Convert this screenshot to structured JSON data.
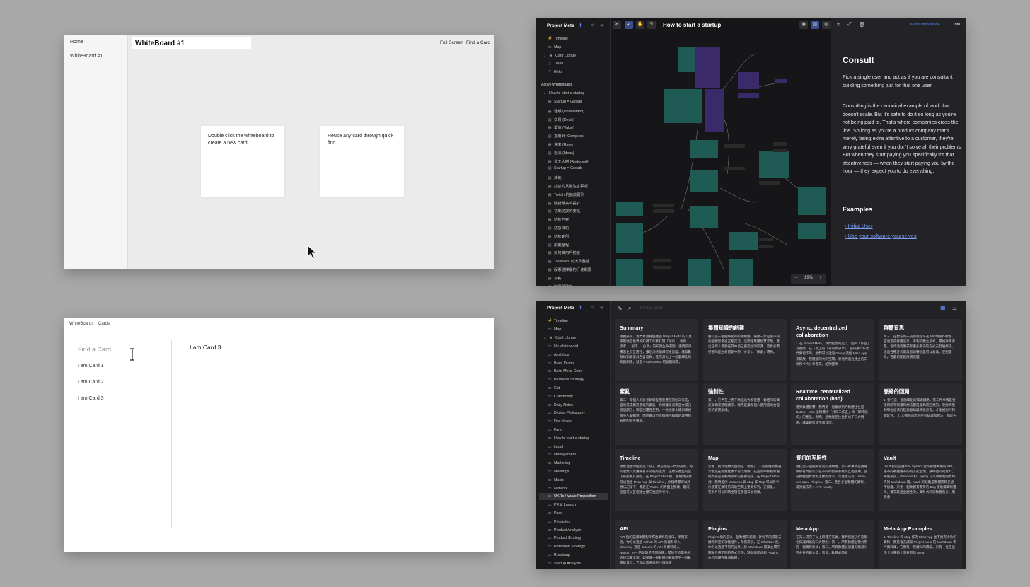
{
  "w1": {
    "sidebar_home": "Home",
    "sidebar_item": "WhiteBoard #1",
    "title": "WhiteBoard #1",
    "btn_fullscreen": "Full Screen",
    "btn_find": "Find a Card",
    "card_a": "Double click the whiteboard to create a new card.",
    "card_b": "Reuse any card through quick find."
  },
  "w2": {
    "nav_whiteboards": "WhiteBoards",
    "nav_cards": "Cards",
    "find_placeholder": "Find a Card",
    "cards": [
      "I am Card 1",
      "I am Card 2",
      "I am Card 3"
    ],
    "selected_title": "I am Card 3"
  },
  "w3": {
    "brand": "Project Meta",
    "nav": [
      "Timeline",
      "Map",
      "Card Library",
      "Trash",
      "Help"
    ],
    "active_label": "Active Whiteboard",
    "active_board": "How to start a startup",
    "board_cards": [
      "Startup = Growth",
      "理解 (Understand)",
      "交易 (Deals)",
      "價值 (Value)",
      "指南針 (Compass)",
      "速率 (Rate)",
      "想法 (Ideas)",
      "參天大樹 (Redwood)",
      "Startup = Growth",
      "其他",
      "訪談的具體注意事項",
      "Twitch 的訪談實例",
      "聽譜最高的設計",
      "初期訪談的要點",
      "訪談內容",
      "訪談目的",
      "訪談範例",
      "創業歷程",
      "如何做用戶訪談",
      "Toussaint 的大局整理",
      "股票選擇權的行使期限",
      "加薪",
      "財團與融資"
    ],
    "title": "How to start a startup",
    "markdown_mode": "MarkDown Mode",
    "info": "Info",
    "heading": "Consult",
    "p1": "Pick a single user and act as if you are consultant building something just for that one user.",
    "p2": "Consulting is the canonical example of work that doesn't scale. But it's safe to do it so long as you're not being paid to. That's where companies cross the line. So long as you're a product company that's merely being extra attentive to a customer, they're very grateful even if you don't solve all their problems. But when they start paying you specifically for that attentiveness — when they start paying you by the hour — they expect you to do everything.",
    "examples": "Examples",
    "link1": "Initial User",
    "link2": "Use your software yourselves",
    "zoom": "19%"
  },
  "w4": {
    "brand": "Project Meta",
    "search_placeholder": "Find a Card",
    "nav": [
      "Timeline",
      "Map",
      "Card Library"
    ],
    "library": [
      "No whiteboard",
      "Analytics",
      "Brain Dump",
      "Build Meta: Diary",
      "Business Strategy",
      "Cat",
      "Community",
      "Daily Notes",
      "Design Philosophy",
      "Dev Notes",
      "Fund",
      "How to start a startup",
      "Legal",
      "Management",
      "Marketing",
      "Meetings",
      "Music",
      "Network",
      "OKRs / Value Proposition",
      "PR & Launch",
      "Pass",
      "Principles",
      "Product Analysis",
      "Product Strategy",
      "Retention Strategy",
      "Roadmap",
      "Startup Analysis"
    ],
    "selected_library": "OKRs / Value Proposition",
    "cards": [
      {
        "t": "Summary",
        "b": "總體來說，我們希望藉由透過 Project Meta 的工具來幫助全世界的知識工作者打開「探索 → 收集 → 思考 → 創作 → 分享」的知識生命週期，讓資訊與備忘生於互用性，讓想法的腦細可被追蹤，讓無數散的知識更具各自發表，進而演化出一個腦細化的知識網路，就是 Project Meta 的長期願景。"
      },
      {
        "t": "集體知識的創建",
        "b": "要打造一個腦細化的知識網路，最後一步是讓不同的個體思考進互相交流，這而讓集體智慧浮現，產出任何人都能在其中自己創造出的知識，這樣必需打通的是生命週期中的「分享」、「探索」環節。"
      },
      {
        "t": "Async, decentralized collaboration",
        "b": "1. 在 Project Meta，我們提倡的是以「個人工作區」為基礎，在下而上的「非同步分享」，當知識工作者們要協作時，他們可以透過 Group 這個 Meta App 來開放一種體驗的共同空間，將他們過往建立的白板和卡片分享進來，給別團隊"
      },
      {
        "t": "群體盲思",
        "b": "第三，在想法尚未成熟就提早進入即時協作狀態，容易造成群體盲思，不利於獨立思考，最終效率考量，協作過程應該考慮多數決的方式去發展想法，透過各種方式刺激思想轉化是可以表達，使到團隊，在最初期就應該提醒。"
      },
      {
        "t": "紊亂",
        "b": "第二，每個人的思考軌跡互相重疊在同個工作區，容易造成資訊系統的紊亂，你很難知道哪些文檔已經過期了，哪些別還在使用，一份協作文檔如果被很多人編輯過，你也難以拉提每個人編輯的理由和背後的思考脈絡。"
      },
      {
        "t": "強制性",
        "b": "第一，它們在上而下地強迫大家使用一套相同的資訊架構來整理資訊，而不是讓每個人使用最適合自己的資訊架構。"
      },
      {
        "t": "Realtime, centeralized collaboration (bad)",
        "b": "提到集體智慧，我們第一個聯想到的軟體往往是 Notion、Miro 這類標榜「共同工作區」和「即時協作」的產品，然而，這類產品往往有以下三大問題，讓集體智慧不容浮現："
      },
      {
        "t": "脈絡的回溯",
        "b": "1. 要打造一個腦細化的知識網路，第二件事情是要確保所有知識和想法都是能夠被回溯的，要能夠看到每個想法的起源脈絡與背後思考，才能被別人持續延伸。 2. 人類創造出的所有知識和想法，都是先"
      },
      {
        "t": "Timeline",
        "b": "收集理想的個別是「快」，想法總是一閃即逝的，好的收集工具應擁有非常低的阻力，在想法產生的當下就能將其捕捉，在 Project Meta 裡，各種資訊都可以透過 Meta App 與 Timeline，你隨時都可以將想法記錄下，像是在 Twitter 的界面上那樣，變成一個個可以互相建立雙向連結的卡片。"
      },
      {
        "t": "Map",
        "b": "思考、創作理想的個別是「視覺」，人的思維架構通常都是在視覺化後才得以明晰，在空間中移動和重組資訊是最輔助思考的重要程序，在 Project Meta 裡，我們提供 Meta App 與 Map 作 Map 可以將卡片放置在無限的白板空間上重新排列，安排後，一張卡片可以同時出現在多個白板裡頭。"
      },
      {
        "t": "資訊的互用性",
        "b": "要打造一個腦細化的知識網路，第一件事情是要確保所有資訊可以在不同的資訊系統間互相使用，當前軟體世界針對這樣的需求，常見做法有：All-in-one app、Plugins、第二、整合多個軟體的資料、常見做法有：API、Vault。"
      },
      {
        "t": "Vault",
        "b": "Vault 指的是將 File System 當作軟體共用的 API，讓不同軟體用不同的方式呈現，讓每個同的資料，舉例來說，Obsidian 和 Logseq 可以共用相同資料夾的 Markdown 檔，Vault 的缺點是軟體間缺乏通用協議，只要一個軟體有需要的 Bug 便能讓資料遺失，擴充就是全面性的，資料共同的軟體愈多，風險愈"
      },
      {
        "t": "API",
        "b": "API 指的是讓軟體對外釋出資料的接口，舉例來說，你可以透過 Github 的 API 將資料導入 Discord，透過 Discord 的 API 將資料導入 Notion，API 的缺點是不同軟體之間的交流需要經過接口來呈現，如果某一個軟體想要取用另一個軟體的資料，它就必需通過另一個軟體"
      },
      {
        "t": "Plugins",
        "b": "Plugins 指的是以一個軟體為基礎，針對不同場景去擴充特定的功能插件，舉例來說，在 Obsidian 裡，你可以透過不同的插件，將 Markdown 檔案之間的關聯性用不同的方式呈現，缺點則是此類 Plugins 依然附屬在單個軟體，"
      },
      {
        "t": "Meta App",
        "b": "在深入研究了以上四種方法後，我們提出了打造腦化知識網路的三大原則：第一，所有軟體必需共用同一個資料格式；第二，所有軟體必須盡可能減少不必要的耦合度；第三，軟體必須能"
      },
      {
        "t": "Meta App Examples",
        "b": "1. Timeline 和 Map 作為 Meta App 並不擁有卡片的資料，而是會去讀取 Project Meta 的 Markdown 卡片資料庫，它們每一種資料的讀取，只有一位在呈現卡片種類上面要有的 meta"
      }
    ]
  }
}
